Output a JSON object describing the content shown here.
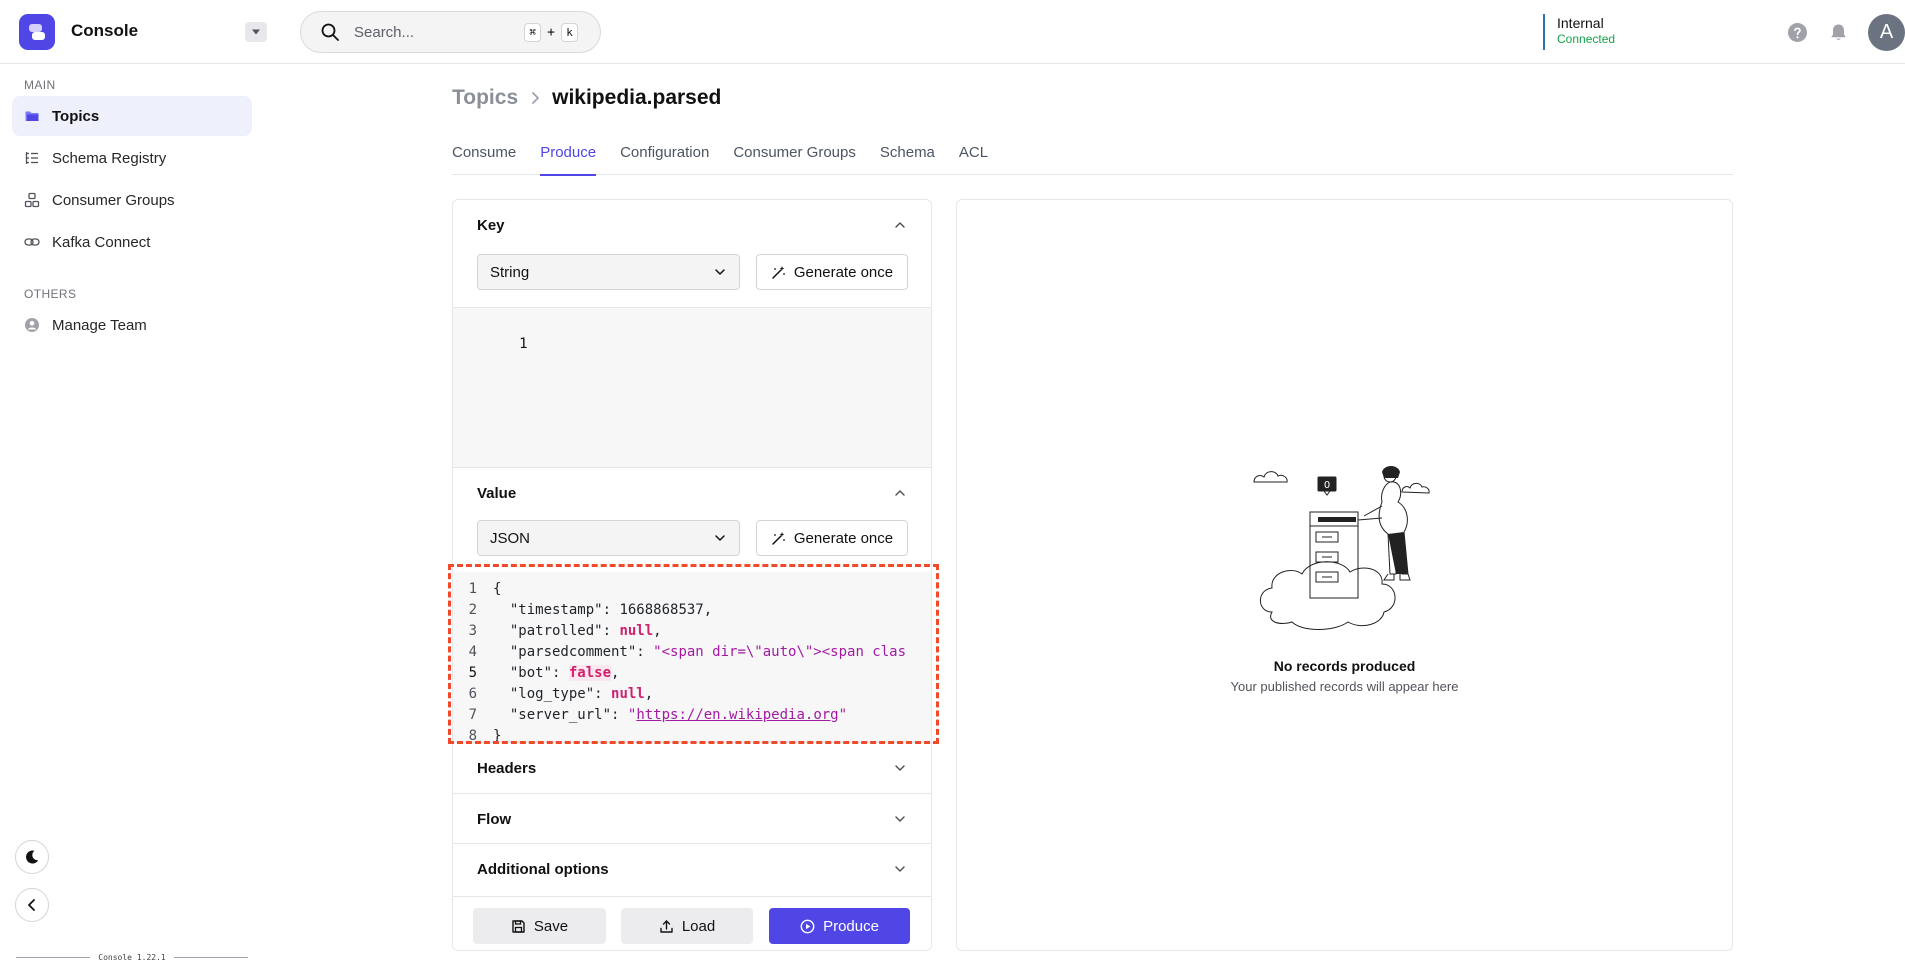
{
  "app": {
    "name": "Console",
    "version": "Console 1.22.1"
  },
  "search": {
    "placeholder": "Search...",
    "shortcut_mod": "⌘",
    "shortcut_plus": "+",
    "shortcut_key": "k"
  },
  "cluster": {
    "name": "Internal",
    "status": "Connected"
  },
  "user": {
    "avatar_initial": "A"
  },
  "sidebar": {
    "main_label": "MAIN",
    "others_label": "OTHERS",
    "items": [
      {
        "label": "Topics",
        "icon": "folder-icon",
        "active": true
      },
      {
        "label": "Schema Registry",
        "icon": "list-tree-icon",
        "active": false
      },
      {
        "label": "Consumer Groups",
        "icon": "groups-icon",
        "active": false
      },
      {
        "label": "Kafka Connect",
        "icon": "link-icon",
        "active": false
      }
    ],
    "other_items": [
      {
        "label": "Manage Team",
        "icon": "user-circle-icon"
      }
    ]
  },
  "breadcrumb": {
    "parent": "Topics",
    "current": "wikipedia.parsed"
  },
  "tabs": [
    "Consume",
    "Produce",
    "Configuration",
    "Consumer Groups",
    "Schema",
    "ACL"
  ],
  "active_tab": "Produce",
  "key_section": {
    "title": "Key",
    "type": "String",
    "generate_label": "Generate once",
    "editor_lines": [
      "1"
    ]
  },
  "value_section": {
    "title": "Value",
    "type": "JSON",
    "generate_label": "Generate once",
    "line_numbers": [
      "1",
      "2",
      "3",
      "4",
      "5",
      "6",
      "7",
      "8"
    ],
    "json": {
      "open": "{",
      "timestamp_key": "\"timestamp\"",
      "timestamp_val": "1668868537",
      "patrolled_key": "\"patrolled\"",
      "patrolled_val": "null",
      "parsedcomment_key": "\"parsedcomment\"",
      "parsedcomment_val": "\"<span dir=\\\"auto\\\"><span clas",
      "bot_key": "\"bot\"",
      "bot_val": "false",
      "log_type_key": "\"log_type\"",
      "log_type_val": "null",
      "server_url_key": "\"server_url\"",
      "server_url_val": "https://en.wikipedia.org",
      "close": "}"
    }
  },
  "collapsed_sections": [
    "Headers",
    "Flow",
    "Additional options"
  ],
  "actions": {
    "save": "Save",
    "load": "Load",
    "produce": "Produce"
  },
  "records": {
    "badge": "0",
    "empty_title": "No records produced",
    "empty_subtitle": "Your published records will appear here"
  },
  "colors": {
    "accent": "#4f46e5",
    "connected": "#16a34a",
    "highlight": "#f04a2a"
  }
}
